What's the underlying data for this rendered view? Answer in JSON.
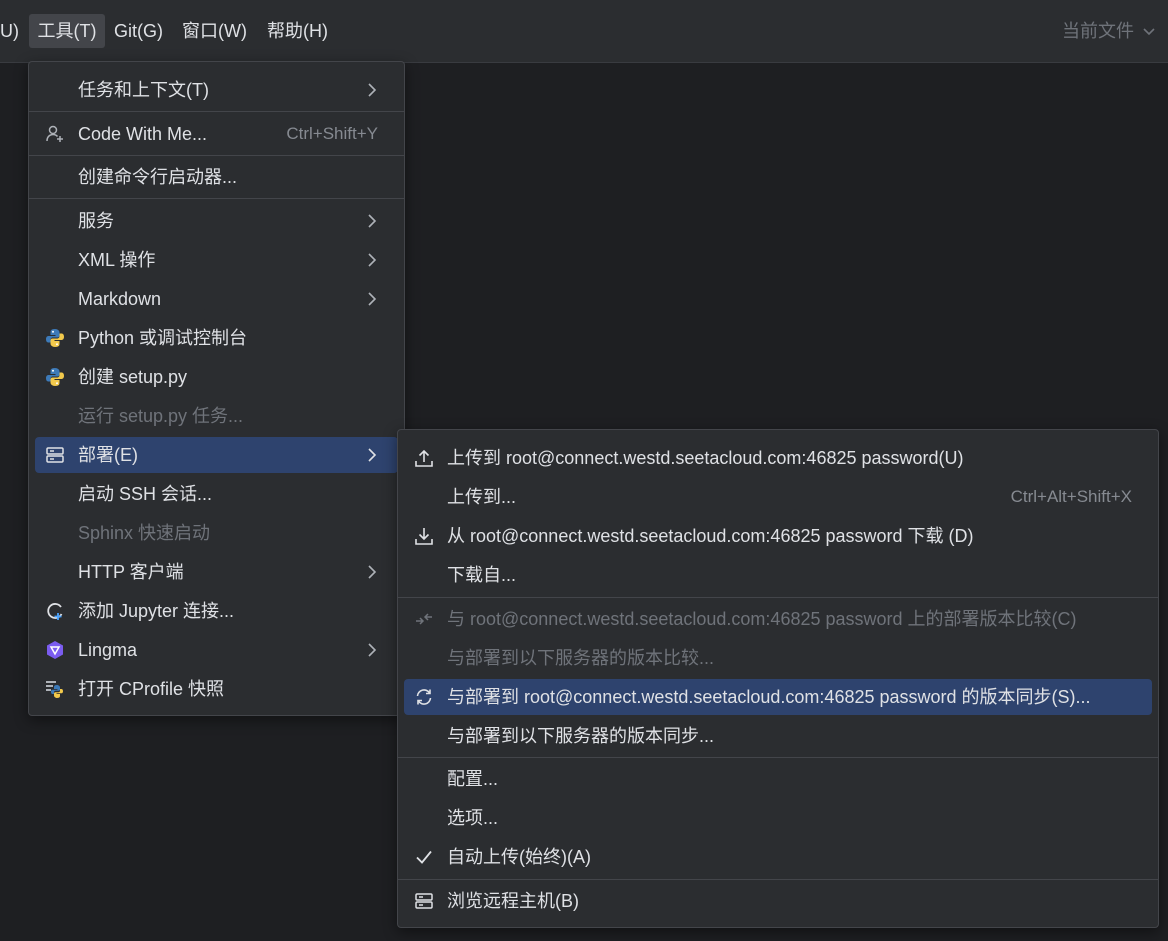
{
  "menubar": {
    "items": [
      {
        "label": "U)"
      },
      {
        "label": "工具(T)"
      },
      {
        "label": "Git(G)"
      },
      {
        "label": "窗口(W)"
      },
      {
        "label": "帮助(H)"
      }
    ],
    "current_file": "当前文件"
  },
  "tools_menu": {
    "items": [
      {
        "label": "任务和上下文(T)"
      },
      {
        "label": "Code With Me...",
        "shortcut": "Ctrl+Shift+Y"
      },
      {
        "label": "创建命令行启动器..."
      },
      {
        "label": "服务"
      },
      {
        "label": "XML 操作"
      },
      {
        "label": "Markdown"
      },
      {
        "label": "Python 或调试控制台"
      },
      {
        "label": "创建 setup.py"
      },
      {
        "label": "运行 setup.py 任务..."
      },
      {
        "label": "部署(E)"
      },
      {
        "label": "启动 SSH 会话..."
      },
      {
        "label": "Sphinx 快速启动"
      },
      {
        "label": "HTTP 客户端"
      },
      {
        "label": "添加 Jupyter 连接..."
      },
      {
        "label": "Lingma"
      },
      {
        "label": "打开 CProfile 快照"
      }
    ]
  },
  "deploy_menu": {
    "items": [
      {
        "label": "上传到 root@connect.westd.seetacloud.com:46825 password(U)"
      },
      {
        "label": "上传到...",
        "shortcut": "Ctrl+Alt+Shift+X"
      },
      {
        "label": "从 root@connect.westd.seetacloud.com:46825 password 下载 (D)"
      },
      {
        "label": "下载自..."
      },
      {
        "label": "与 root@connect.westd.seetacloud.com:46825 password 上的部署版本比较(C)"
      },
      {
        "label": "与部署到以下服务器的版本比较..."
      },
      {
        "label": "与部署到 root@connect.westd.seetacloud.com:46825 password 的版本同步(S)..."
      },
      {
        "label": "与部署到以下服务器的版本同步..."
      },
      {
        "label": "配置..."
      },
      {
        "label": "选项..."
      },
      {
        "label": "自动上传(始终)(A)"
      },
      {
        "label": "浏览远程主机(B)"
      }
    ]
  },
  "colors": {
    "background": "#1e1f22",
    "menu_bg": "#2b2d30",
    "highlight": "#2e436e",
    "text": "#dfe1e5",
    "disabled_text": "#6f737a",
    "python_blue": "#3d7ab8",
    "python_yellow": "#f2c94c",
    "lingma_purple": "#7b5cf0"
  },
  "icons": [
    "user-plus-icon",
    "python-icon",
    "server-icon",
    "jupyter-icon",
    "lingma-icon",
    "cprofile-icon",
    "upload-icon",
    "download-icon",
    "compare-icon",
    "sync-icon",
    "check-icon",
    "chevron-right-icon",
    "chevron-down-icon"
  ]
}
